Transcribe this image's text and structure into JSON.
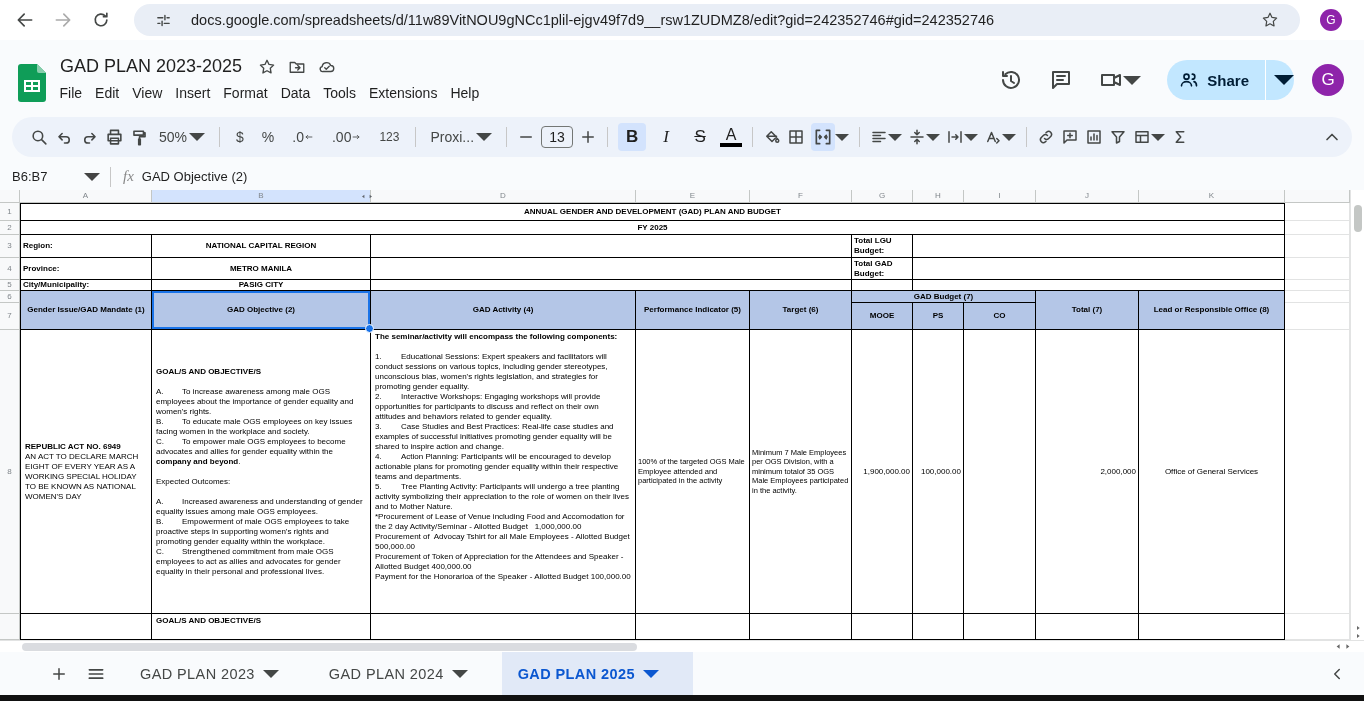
{
  "browser": {
    "url": "docs.google.com/spreadsheets/d/11w89VitNOU9gNCc1plil-ejgv49f7d9__rsw1ZUDMZ8/edit?gid=242352746#gid=242352746",
    "profile": "G"
  },
  "document": {
    "title": "GAD PLAN 2023-2025",
    "menus": [
      "File",
      "Edit",
      "View",
      "Insert",
      "Format",
      "Data",
      "Tools",
      "Extensions",
      "Help"
    ],
    "share": "Share",
    "avatar": "G"
  },
  "toolbar": {
    "zoom": "50%",
    "formats": [
      {
        "kind": "currency",
        "label": "$"
      },
      {
        "kind": "percent",
        "label": "%"
      },
      {
        "kind": "decimal_decrease",
        "label": ".0"
      },
      {
        "kind": "decimal_increase",
        "label": ".00"
      },
      {
        "kind": "number",
        "label": "123"
      }
    ],
    "font": "Proxi...",
    "font_size": "13",
    "styles": [
      {
        "kind": "bold",
        "label": "B",
        "active": true
      },
      {
        "kind": "italic",
        "label": "I",
        "active": false
      },
      {
        "kind": "strike",
        "label": "S",
        "active": false
      }
    ],
    "text_color": "A",
    "merge_active": true
  },
  "formula_bar": {
    "name_box": "B6:B7",
    "fx": "fx",
    "value": "GAD Objective (2)"
  },
  "sheet": {
    "columns": [
      {
        "label": "A",
        "selected": false
      },
      {
        "label": "B",
        "selected": true
      },
      {
        "label": "D",
        "selected": false
      },
      {
        "label": "E",
        "selected": false
      },
      {
        "label": "F",
        "selected": false
      },
      {
        "label": "G",
        "selected": false
      },
      {
        "label": "H",
        "selected": false
      },
      {
        "label": "I",
        "selected": false
      },
      {
        "label": "J",
        "selected": false
      },
      {
        "label": "K",
        "selected": false
      }
    ],
    "row_numbers": [
      "1",
      "2",
      "3",
      "4",
      "5",
      "6",
      "7",
      "8"
    ],
    "title": "ANNUAL GENDER AND DEVELOPMENT (GAD) PLAN AND BUDGET",
    "fiscal_year": "FY 2025",
    "info": [
      {
        "label": "Region:",
        "value": "NATIONAL CAPITAL REGION"
      },
      {
        "label": "Province:",
        "value": "METRO MANILA"
      },
      {
        "label": "City/Municipality:",
        "value": "PASIG CITY"
      }
    ],
    "budget_labels": [
      "Total LGU Budget:",
      "Total GAD Budget:"
    ],
    "headers": [
      {
        "text": "Gender Issue/GAD Mandate (1)",
        "selected": false
      },
      {
        "text": "GAD Objective (2)",
        "selected": true
      },
      {
        "text": "GAD Activity (4)",
        "selected": false
      },
      {
        "text": "Performance Indicator (5)",
        "selected": false
      },
      {
        "text": "Target (6)",
        "selected": false
      },
      {
        "text": "Total (7)",
        "selected": false
      },
      {
        "text": "Lead or Responsible Office (8)",
        "selected": false
      }
    ],
    "budget_group": {
      "label": "GAD Budget (7)",
      "subheaders": [
        "MOOE",
        "PS",
        "CO"
      ]
    },
    "rows": [
      {
        "mandate": "**REPUBLIC ACT NO. 6949**\nAN ACT TO DECLARE MARCH EIGHT OF EVERY YEAR AS A WORKING SPECIAL HOLIDAY TO BE KNOWN AS NATIONAL WOMEN'S DAY",
        "objective": "**GOAL/S AND OBJECTIVE/S**\n\nA.\tTo increase awareness among male OGS employees about the importance of gender equality and women's rights.\nB.\tTo educate male OGS employees on key issues facing women in the workplace and society.\nC.\tTo empower male OGS employees to become advocates and allies for gender equality within the **company and beyond**.\n\nExpected Outcomes:\n\nA.\tIncreased awareness and understanding of gender equality issues among male OGS employees.\nB.\tEmpowerment of male OGS employees to take proactive steps in supporting women's rights and promoting gender equality within the workplace.\nC.\tStrengthened commitment from male OGS employees to act as allies and advocates for gender equality in their personal and professional lives.",
        "activity": "**The seminar/activity will encompass the following components:**\n\n1.\tEducational Sessions: Expert speakers and facilitators will conduct sessions on various topics, including gender stereotypes, unconscious bias, women's rights legislation, and strategies for promoting gender equality.\n2.\tInteractive Workshops: Engaging workshops will provide opportunities for participants to discuss and reflect on their own attitudes and behaviors related to gender equality.\n3.\tCase Studies and Best Practices: Real-life case studies and examples of successful initiatives promoting gender equality will be shared to inspire action and change.\n4.\tAction Planning: Participants will be encouraged to develop actionable plans for promoting gender equality within their respective teams and departments.\n5.\tTree Planting Activity: Participants will undergo a tree planting activity symbolizing their appreciation to the role of women on their lives and to Mother Nature.\n*Procurement of Lease of Venue including Food and Accomodation for the 2 day Activity/Seminar - Allotted Budget   1,000,000.00\nProcurement of  Advocay Tshirt for all Male Employees - Allotted Budget  500,000.00\nProcurement of Token of Appreciation for the Attendees and Speaker - Allotted Budget 400,000.00\nPayment for the Honorarioa of the Speaker - Allotted Budget 100,000.00",
        "indicator": "100% of the targeted OGS Male Employee attended and participated in the activity",
        "target": "Minimum 7 Male Employees per OGS Division, with a minimum totalof 35 OGS Male Employees  participated in the activity.",
        "mooe": "1,900,000.00",
        "ps": "100,000.00",
        "total": "2,000,000",
        "office": "Office of General Services"
      },
      {
        "objective": "**GOAL/S AND OBJECTIVE/S**"
      }
    ]
  },
  "sheet_tabs": [
    {
      "label": "GAD PLAN 2023",
      "selected": false
    },
    {
      "label": "GAD PLAN 2024",
      "selected": false
    },
    {
      "label": "GAD PLAN 2025",
      "selected": true
    }
  ]
}
